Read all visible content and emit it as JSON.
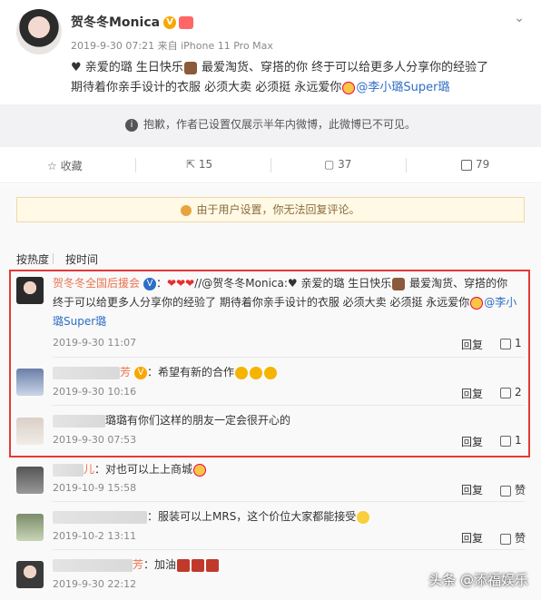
{
  "post": {
    "author": "贺冬冬Monica",
    "verified_mark": "V",
    "meta": "2019-9-30 07:21 来自 iPhone 11 Pro Max",
    "text_line1_a": "♥ 亲爱的璐 生日快乐",
    "text_line1_b": " 最爱淘货、穿搭的你 终于可以给更多人分享你的经验了",
    "text_line2_a": "期待着你亲手设计的衣服 必须大卖 必须挺 永远爱你",
    "mention": "@李小璐Super璐",
    "chevron": "⌄"
  },
  "notice": {
    "icon": "i",
    "text": "抱歉，作者已设置仅展示半年内微博，此微博已不可见。"
  },
  "actions": {
    "favorite": "收藏",
    "repost_count": "15",
    "comment_count": "37",
    "like_count": "79"
  },
  "comments_section": {
    "reply_warning": "由于用户设置，你无法回复评论。",
    "sort_hot": "按热度",
    "sort_time": "按时间"
  },
  "comments": [
    {
      "name": "贺冬冬全国后援会",
      "verified_mark": "V",
      "hearts": "❤❤❤",
      "text_a": "//@贺冬冬Monica:♥ 亲爱的璐 生日快乐",
      "text_b": " 最爱淘货、穿搭的你",
      "text_line2_a": "终于可以给更多人分享你的经验了 期待着你亲手设计的衣服 必须大卖 必须挺 永远爱你",
      "mention_a": "@李小",
      "mention_b": "璐Super璐",
      "date": "2019-9-30 11:07",
      "reply": "回复",
      "likes": "1"
    },
    {
      "name_visible": "芳",
      "verified_mark": "V",
      "text": "：希望有新的合作",
      "date": "2019-9-30 10:16",
      "reply": "回复",
      "likes": "2"
    },
    {
      "text": "璐璐有你们这样的朋友一定会很开心的",
      "date": "2019-9-30 07:53",
      "reply": "回复",
      "likes": "1"
    },
    {
      "name_visible": "儿",
      "text": "：对也可以上上商城",
      "date": "2019-10-9 15:58",
      "reply": "回复",
      "likes": "赞"
    },
    {
      "text": "：服装可以上MRS，这个价位大家都能接受",
      "date": "2019-10-2 13:11",
      "reply": "回复",
      "likes": "赞"
    },
    {
      "name_visible": "芳",
      "text": "：加油",
      "date": "2019-9-30 22:12",
      "reply": "回复",
      "likes": "赞"
    }
  ],
  "watermark": "头条 @添福娱乐"
}
